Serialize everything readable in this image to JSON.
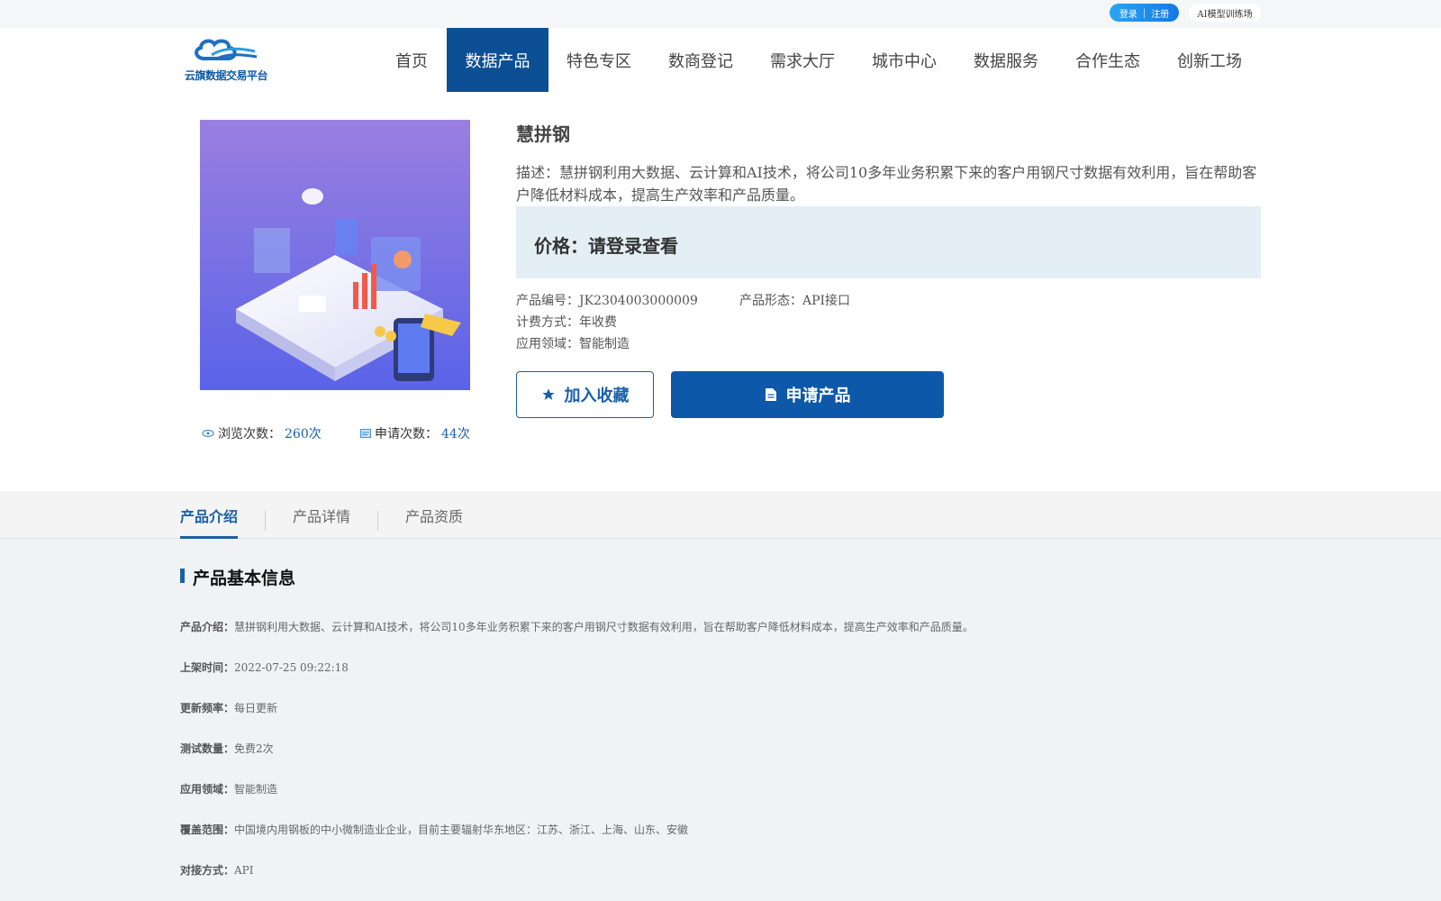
{
  "topbar": {
    "login": "登录",
    "separator": "|",
    "register": "注册",
    "ai_link": "AI模型训练场"
  },
  "logo": {
    "text": "云旗数据交易平台"
  },
  "nav": [
    {
      "label": "首页",
      "active": false
    },
    {
      "label": "数据产品",
      "active": true
    },
    {
      "label": "特色专区",
      "active": false
    },
    {
      "label": "数商登记",
      "active": false
    },
    {
      "label": "需求大厅",
      "active": false
    },
    {
      "label": "城市中心",
      "active": false
    },
    {
      "label": "数据服务",
      "active": false
    },
    {
      "label": "合作生态",
      "active": false
    },
    {
      "label": "创新工场",
      "active": false
    }
  ],
  "product": {
    "title": "慧拼钢",
    "description": "描述：慧拼钢利用大数据、云计算和AI技术，将公司10多年业务积累下来的客户用钢尺寸数据有效利用，旨在帮助客户降低材料成本，提高生产效率和产品质量。",
    "price": "价格：请登录查看",
    "code": "产品编号：JK2304003000009",
    "form": "产品形态：API接口",
    "billing": "计费方式：年收费",
    "field": "应用领域：智能制造",
    "fav_label": "加入收藏",
    "apply_label": "申请产品",
    "views_label": "浏览次数：",
    "views_value": "260次",
    "applies_label": "申请次数：",
    "applies_value": "44次"
  },
  "tabs": [
    {
      "label": "产品介绍",
      "active": true
    },
    {
      "label": "产品详情",
      "active": false
    },
    {
      "label": "产品资质",
      "active": false
    }
  ],
  "info": {
    "section_title": "产品基本信息",
    "rows": [
      {
        "label": "产品介绍：",
        "value": "慧拼钢利用大数据、云计算和AI技术，将公司10多年业务积累下来的客户用钢尺寸数据有效利用，旨在帮助客户降低材料成本，提高生产效率和产品质量。"
      },
      {
        "label": "上架时间：",
        "value": "2022-07-25 09:22:18"
      },
      {
        "label": "更新频率：",
        "value": "每日更新"
      },
      {
        "label": "测试数量：",
        "value": "免费2次"
      },
      {
        "label": "应用领域：",
        "value": "智能制造"
      },
      {
        "label": "覆盖范围：",
        "value": "中国境内用钢板的中小微制造业企业，目前主要辐射华东地区：江苏、浙江、上海、山东、安徽"
      },
      {
        "label": "对接方式：",
        "value": "API"
      }
    ]
  },
  "colors": {
    "brand": "#0d4f94",
    "accent": "#1a5fa8",
    "price_bg": "#e3eff4"
  }
}
